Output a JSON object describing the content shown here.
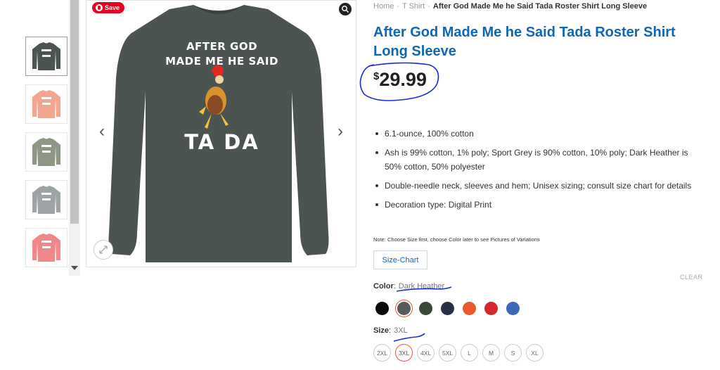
{
  "gallery": {
    "thumbnails": [
      {
        "name": "dark-heather-thumb",
        "color": "#4b5451",
        "active": true
      },
      {
        "name": "peach-thumb",
        "color": "#f4a58e",
        "active": false
      },
      {
        "name": "sage-thumb",
        "color": "#8e9784",
        "active": false
      },
      {
        "name": "sport-grey-thumb",
        "color": "#9ea3a6",
        "active": false
      },
      {
        "name": "coral-thumb",
        "color": "#f08789",
        "active": false
      }
    ],
    "main_image": {
      "shirt_color": "#4b5451",
      "print_line1": "AFTER GOD",
      "print_line2": "MADE ME HE SAID",
      "print_line3": "TA DA"
    },
    "save_label": "Save",
    "prev_arrow": "‹",
    "next_arrow": "›",
    "icons": {
      "save": "pinterest-icon",
      "zoom": "zoom-icon",
      "expand": "expand-icon"
    }
  },
  "breadcrumb": {
    "items": [
      "Home",
      "T Shirt"
    ],
    "current": "After God Made Me he Said Tada Roster Shirt Long Sleeve",
    "separator": "-"
  },
  "product": {
    "title": "After God Made Me he Said Tada Roster Shirt Long Sleeve",
    "currency": "$",
    "price": "29.99",
    "features": [
      "6.1-ounce, 100% cotton",
      "Ash is 99% cotton, 1% poly; Sport Grey is 90% cotton, 10% poly; Dark Heather is 50% cotton, 50% polyester",
      "Double-needle neck, sleeves and hem; Unisex sizing; consult size chart for details",
      "Decoration type: Digital Print"
    ],
    "note": "Note: Choose Size first, choose Color later to see Pictures of Variations",
    "size_chart_label": "Size-Chart",
    "clear_label": "CLEAR"
  },
  "color_option": {
    "label": "Color",
    "value": "Dark Heather",
    "swatches": [
      {
        "name": "black",
        "hex": "#0b0b0b",
        "selected": false
      },
      {
        "name": "dark-heather",
        "hex": "#555a5a",
        "selected": true
      },
      {
        "name": "forest",
        "hex": "#3a4a35",
        "selected": false
      },
      {
        "name": "navy",
        "hex": "#253044",
        "selected": false
      },
      {
        "name": "orange",
        "hex": "#e85c2c",
        "selected": false
      },
      {
        "name": "red",
        "hex": "#d6262e",
        "selected": false
      },
      {
        "name": "royal",
        "hex": "#3d68b8",
        "selected": false
      }
    ]
  },
  "size_option": {
    "label": "Size",
    "value": "3XL",
    "sizes": [
      "2XL",
      "3XL",
      "4XL",
      "5XL",
      "L",
      "M",
      "S",
      "XL"
    ],
    "selected": "3XL"
  },
  "colors": {
    "accent": "#1166b4",
    "selected_ring": "#e25a40",
    "annotation": "#1a2fd1"
  }
}
